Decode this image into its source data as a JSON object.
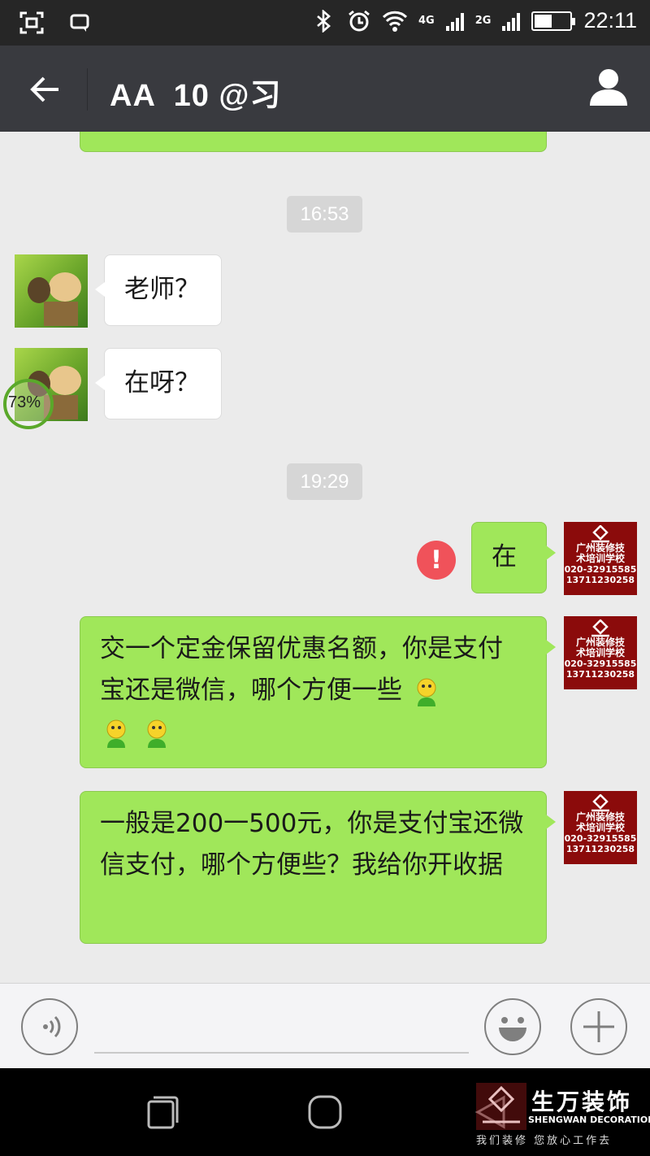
{
  "status_bar": {
    "network_labels": [
      "4G",
      "2G",
      "2G"
    ],
    "time": "22:11"
  },
  "header": {
    "title": "AA  10 @习"
  },
  "messages": {
    "timestamp_1": "16:53",
    "msg_1": "老师？",
    "msg_2": "在呀？",
    "upload_progress": "73%",
    "timestamp_2": "19:29",
    "msg_3": "在",
    "msg_4": "交一个定金保留优惠名额，你是支付宝还是微信，哪个方便一些",
    "msg_5": "一般是200一500元，你是支付宝还微信支付，哪个方便些？我给你开收据",
    "send_error_mark": "!"
  },
  "school_avatar": {
    "line1": "广州装修技",
    "line2": "术培训学校",
    "line3": "020-32915585",
    "line4": "13711230258"
  },
  "watermark": {
    "brand": "生万装饰",
    "brand_en": "SHENGWAN DECORATION",
    "slogan": "我们装修  您放心工作去"
  },
  "colors": {
    "header_bg": "#393a3f",
    "sent_bubble": "#a0e75a",
    "received_bubble": "#ffffff",
    "error_red": "#f0525a"
  }
}
